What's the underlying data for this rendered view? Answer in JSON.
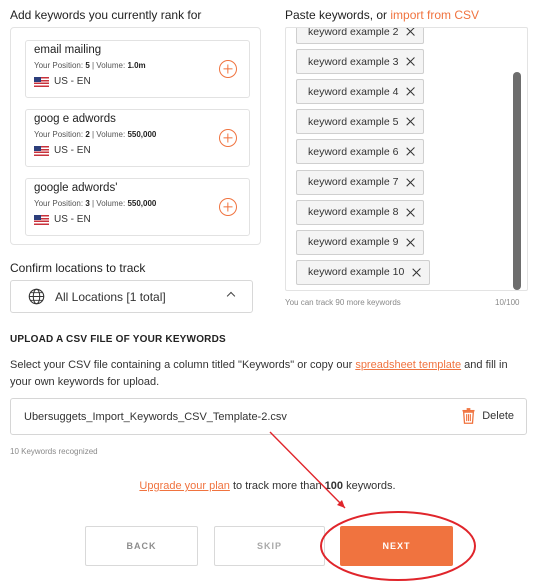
{
  "left_section": {
    "heading": "Add keywords you currently rank for",
    "position_label": "Your Position:",
    "volume_label": "Volume:",
    "keywords": [
      {
        "name": "email mailing",
        "position": "5",
        "volume": "1.0m",
        "location": "US - EN"
      },
      {
        "name": "goog e adwords",
        "position": "2",
        "volume": "550,000",
        "location": "US - EN"
      },
      {
        "name": "google adwords'",
        "position": "3",
        "volume": "550,000",
        "location": "US - EN"
      }
    ]
  },
  "locations": {
    "heading": "Confirm locations to track",
    "selected": "All Locations [1 total]"
  },
  "right_section": {
    "heading_prefix": "Paste keywords, or ",
    "heading_link": "import from CSV",
    "tags": [
      "keyword example 2",
      "keyword example 3",
      "keyword example 4",
      "keyword example 5",
      "keyword example 6",
      "keyword example 7",
      "keyword example 8",
      "keyword example 9",
      "keyword example 10"
    ],
    "track_note": "You can track 90 more keywords",
    "track_count": "10/100"
  },
  "upload": {
    "title": "UPLOAD A CSV FILE OF YOUR KEYWORDS",
    "desc_before": "Select your CSV file containing a column titled \"Keywords\" or copy our ",
    "desc_link": "spreadsheet template",
    "desc_after": " and fill in your own keywords for upload.",
    "file_name": "Ubersuggets_Import_Keywords_CSV_Template-2.csv",
    "delete_label": "Delete",
    "recognized": "10 Keywords recognized"
  },
  "upgrade": {
    "link": "Upgrade your plan",
    "text_before_num": " to track more than ",
    "number": "100",
    "text_after": " keywords."
  },
  "buttons": {
    "back": "BACK",
    "skip": "SKIP",
    "next": "NEXT"
  },
  "colors": {
    "accent": "#f0733f",
    "annotation": "#e0252b"
  }
}
